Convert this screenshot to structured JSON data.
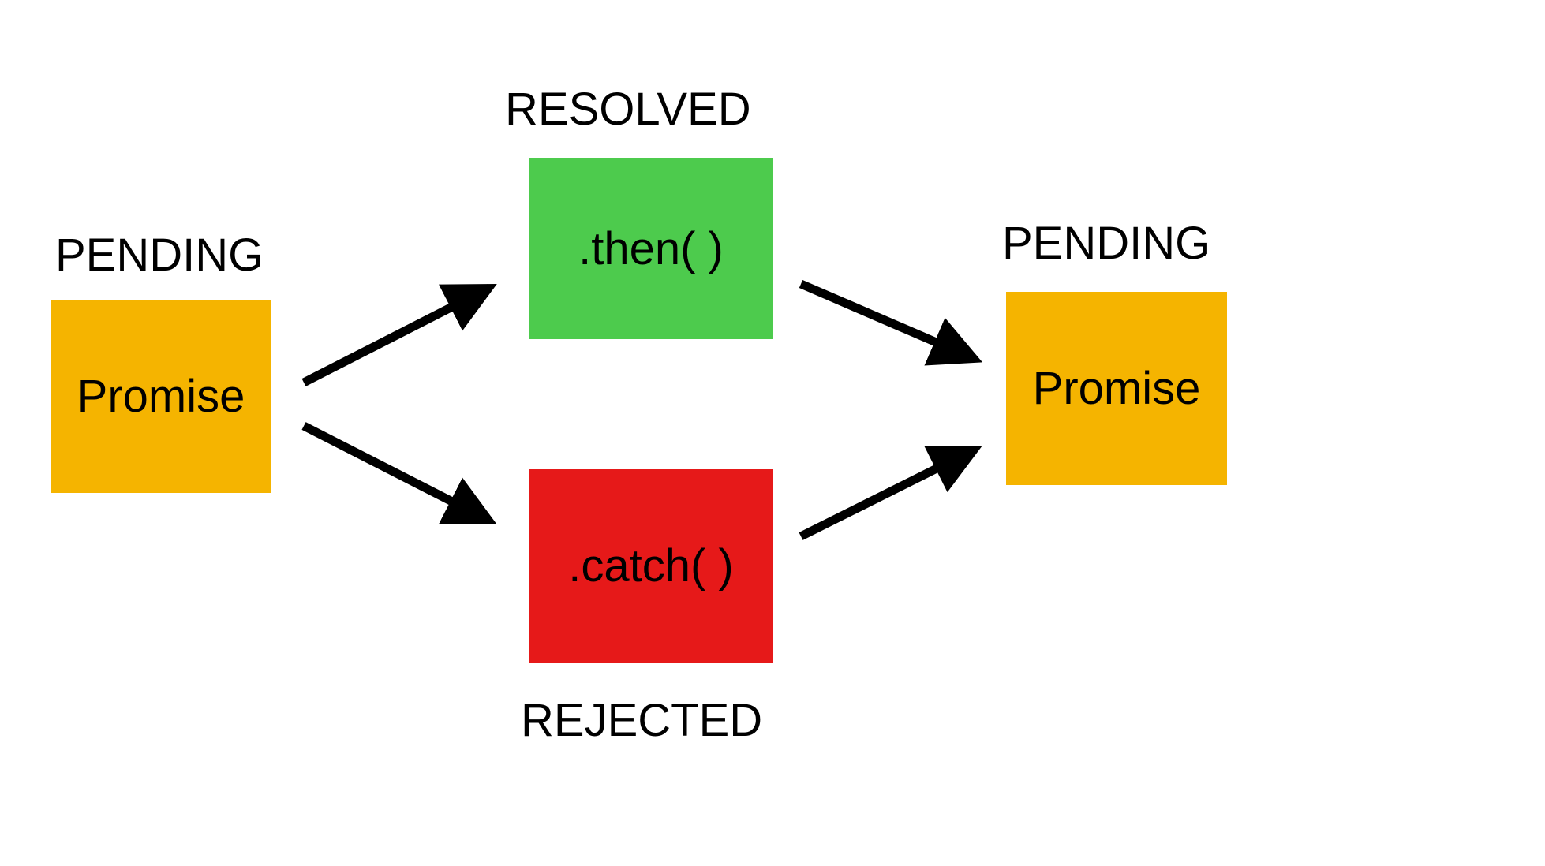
{
  "labels": {
    "pending_left": "PENDING",
    "resolved": "RESOLVED",
    "rejected": "REJECTED",
    "pending_right": "PENDING"
  },
  "boxes": {
    "promise_left": "Promise",
    "then": ".then( )",
    "catch": ".catch( )",
    "promise_right": "Promise"
  },
  "colors": {
    "orange": "#f5b400",
    "green": "#4dcb4d",
    "red": "#e61919"
  }
}
